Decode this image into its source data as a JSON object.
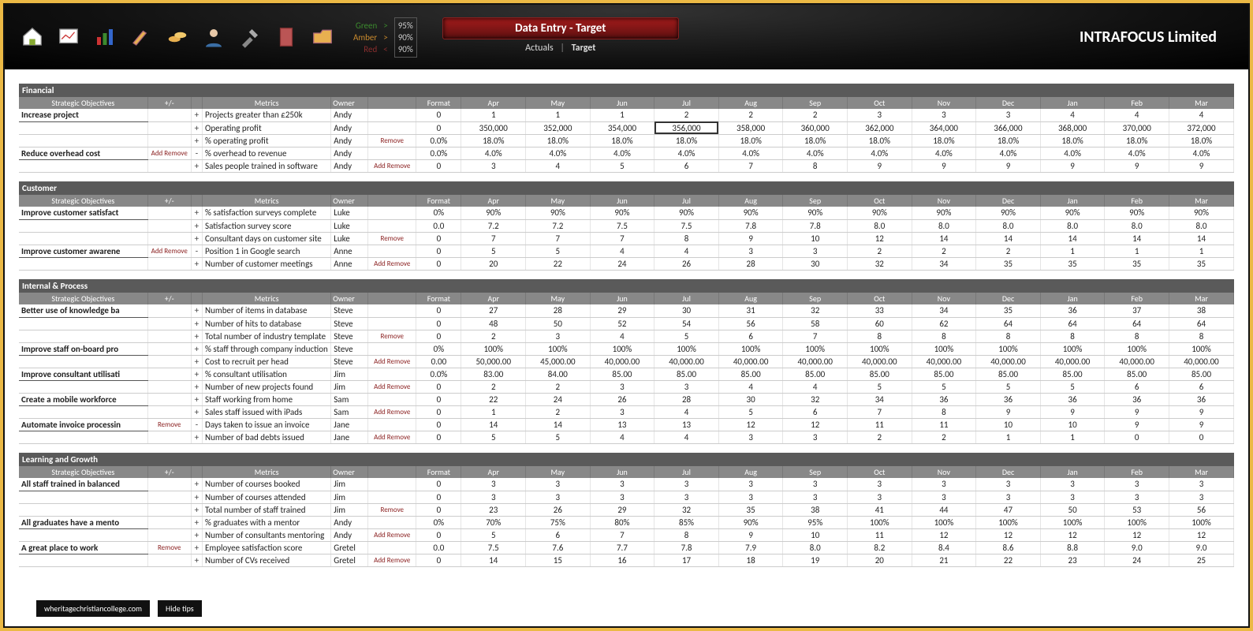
{
  "brand": "INTRAFOCUS Limited",
  "toolbar": {
    "title": "Data Entry - Target",
    "sub_actuals": "Actuals",
    "sub_sep": "|",
    "sub_target": "Target",
    "rag": {
      "green_label": "Green",
      "amber_label": "Amber",
      "red_label": "Red",
      "gt": ">",
      "lt": "<",
      "green_val": "95%",
      "amber_val": "90%",
      "red_val": "90%"
    }
  },
  "footer": {
    "domain": "wheritagechristiancollege.com",
    "hidetips": "Hide tips"
  },
  "col_headers": {
    "obj": "Strategic Objectives",
    "pm": "+/-",
    "metrics": "Metrics",
    "owner": "Owner",
    "format": "Format",
    "months": [
      "Apr",
      "May",
      "Jun",
      "Jul",
      "Aug",
      "Sep",
      "Oct",
      "Nov",
      "Dec",
      "Jan",
      "Feb",
      "Mar"
    ]
  },
  "sections": [
    {
      "title": "Financial",
      "rows": [
        {
          "obj": "Increase project",
          "objAR": "",
          "plus": "+",
          "metric": "Projects greater than £250k",
          "owner": "Andy",
          "ar": "",
          "fmt": "0",
          "v": [
            "1",
            "1",
            "1",
            "2",
            "2",
            "2",
            "3",
            "3",
            "3",
            "4",
            "4",
            "4"
          ]
        },
        {
          "obj": "",
          "objAR": "",
          "plus": "+",
          "metric": "Operating profit",
          "owner": "Andy",
          "ar": "",
          "fmt": "0",
          "v": [
            "350,000",
            "352,000",
            "354,000",
            "356,000",
            "358,000",
            "360,000",
            "362,000",
            "364,000",
            "366,000",
            "368,000",
            "370,000",
            "372,000"
          ],
          "selected": 3
        },
        {
          "obj": "",
          "objAR": "",
          "plus": "+",
          "metric": "% operating profit",
          "owner": "Andy",
          "ar": "Remove",
          "fmt": "0.0%",
          "v": [
            "18.0%",
            "18.0%",
            "18.0%",
            "18.0%",
            "18.0%",
            "18.0%",
            "18.0%",
            "18.0%",
            "18.0%",
            "18.0%",
            "18.0%",
            "18.0%"
          ]
        },
        {
          "obj": "Reduce overhead cost",
          "objAR": "Add  Remove",
          "plus": "-",
          "metric": "% overhead to revenue",
          "owner": "Andy",
          "ar": "",
          "fmt": "0.0%",
          "v": [
            "4.0%",
            "4.0%",
            "4.0%",
            "4.0%",
            "4.0%",
            "4.0%",
            "4.0%",
            "4.0%",
            "4.0%",
            "4.0%",
            "4.0%",
            "4.0%"
          ]
        },
        {
          "obj": "",
          "objAR": "",
          "plus": "+",
          "metric": "Sales people trained in software",
          "owner": "Andy",
          "ar": "Add  Remove",
          "fmt": "0",
          "v": [
            "3",
            "4",
            "5",
            "6",
            "7",
            "8",
            "9",
            "9",
            "9",
            "9",
            "9",
            "9"
          ]
        }
      ]
    },
    {
      "title": "Customer",
      "rows": [
        {
          "obj": "Improve customer satisfact",
          "objAR": "",
          "plus": "+",
          "metric": "% satisfaction surveys complete",
          "owner": "Luke",
          "ar": "",
          "fmt": "0%",
          "v": [
            "90%",
            "90%",
            "90%",
            "90%",
            "90%",
            "90%",
            "90%",
            "90%",
            "90%",
            "90%",
            "90%",
            "90%"
          ]
        },
        {
          "obj": "",
          "objAR": "",
          "plus": "+",
          "metric": "Satisfaction survey score",
          "owner": "Luke",
          "ar": "",
          "fmt": "0.0",
          "v": [
            "7.2",
            "7.2",
            "7.5",
            "7.5",
            "7.8",
            "7.8",
            "8.0",
            "8.0",
            "8.0",
            "8.0",
            "8.0",
            "8.0"
          ]
        },
        {
          "obj": "",
          "objAR": "",
          "plus": "+",
          "metric": "Consultant days on customer site",
          "owner": "Luke",
          "ar": "Remove",
          "fmt": "0",
          "v": [
            "7",
            "7",
            "7",
            "8",
            "9",
            "10",
            "12",
            "14",
            "14",
            "14",
            "14",
            "14"
          ]
        },
        {
          "obj": "Improve customer awarene",
          "objAR": "Add  Remove",
          "plus": "-",
          "metric": "Position 1 in Google search",
          "owner": "Anne",
          "ar": "",
          "fmt": "0",
          "v": [
            "5",
            "5",
            "4",
            "4",
            "3",
            "3",
            "2",
            "2",
            "2",
            "1",
            "1",
            "1"
          ]
        },
        {
          "obj": "",
          "objAR": "",
          "plus": "+",
          "metric": "Number of customer meetings",
          "owner": "Anne",
          "ar": "Add  Remove",
          "fmt": "0",
          "v": [
            "20",
            "22",
            "24",
            "26",
            "28",
            "30",
            "32",
            "34",
            "35",
            "35",
            "35",
            "35"
          ]
        }
      ]
    },
    {
      "title": "Internal & Process",
      "rows": [
        {
          "obj": "Better use of knowledge ba",
          "objAR": "",
          "plus": "+",
          "metric": "Number of items in database",
          "owner": "Steve",
          "ar": "",
          "fmt": "0",
          "v": [
            "27",
            "28",
            "29",
            "30",
            "31",
            "32",
            "33",
            "34",
            "35",
            "36",
            "37",
            "38"
          ]
        },
        {
          "obj": "",
          "objAR": "",
          "plus": "+",
          "metric": "Number of hits to database",
          "owner": "Steve",
          "ar": "",
          "fmt": "0",
          "v": [
            "48",
            "50",
            "52",
            "54",
            "56",
            "58",
            "60",
            "62",
            "64",
            "64",
            "64",
            "64"
          ]
        },
        {
          "obj": "",
          "objAR": "",
          "plus": "+",
          "metric": "Total number of industry template",
          "owner": "Steve",
          "ar": "Remove",
          "fmt": "0",
          "v": [
            "2",
            "3",
            "4",
            "5",
            "6",
            "7",
            "8",
            "8",
            "8",
            "8",
            "8",
            "8"
          ]
        },
        {
          "obj": "Improve staff on-board pro",
          "objAR": "",
          "plus": "+",
          "metric": "% staff through company induction",
          "owner": "Steve",
          "ar": "",
          "fmt": "0%",
          "v": [
            "100%",
            "100%",
            "100%",
            "100%",
            "100%",
            "100%",
            "100%",
            "100%",
            "100%",
            "100%",
            "100%",
            "100%"
          ]
        },
        {
          "obj": "",
          "objAR": "",
          "plus": "+",
          "metric": "Cost to recruit per head",
          "owner": "Steve",
          "ar": "Add  Remove",
          "fmt": "0.00",
          "v": [
            "50,000.00",
            "45,000.00",
            "40,000.00",
            "40,000.00",
            "40,000.00",
            "40,000.00",
            "40,000.00",
            "40,000.00",
            "40,000.00",
            "40,000.00",
            "40,000.00",
            "40,000.00"
          ]
        },
        {
          "obj": "Improve consultant utilisati",
          "objAR": "",
          "plus": "+",
          "metric": "% consultant utilisation",
          "owner": "Jim",
          "ar": "",
          "fmt": "0.0%",
          "v": [
            "83.00",
            "84.00",
            "85.00",
            "85.00",
            "85.00",
            "85.00",
            "85.00",
            "85.00",
            "85.00",
            "85.00",
            "85.00",
            "85.00"
          ]
        },
        {
          "obj": "",
          "objAR": "",
          "plus": "+",
          "metric": "Number of new projects found",
          "owner": "Jim",
          "ar": "Add  Remove",
          "fmt": "0",
          "v": [
            "2",
            "2",
            "3",
            "3",
            "4",
            "4",
            "5",
            "5",
            "5",
            "5",
            "6",
            "6"
          ]
        },
        {
          "obj": "Create a mobile workforce",
          "objAR": "",
          "plus": "+",
          "metric": "Staff working from home",
          "owner": "Sam",
          "ar": "",
          "fmt": "0",
          "v": [
            "22",
            "24",
            "26",
            "28",
            "30",
            "32",
            "34",
            "36",
            "36",
            "36",
            "36",
            "36"
          ]
        },
        {
          "obj": "",
          "objAR": "",
          "plus": "+",
          "metric": "Sales staff issued with iPads",
          "owner": "Sam",
          "ar": "Add  Remove",
          "fmt": "0",
          "v": [
            "1",
            "2",
            "3",
            "4",
            "5",
            "6",
            "7",
            "8",
            "9",
            "9",
            "9",
            "9"
          ]
        },
        {
          "obj": "Automate invoice processin",
          "objAR": "Remove",
          "plus": "-",
          "metric": "Days taken to issue an invoice",
          "owner": "Jane",
          "ar": "",
          "fmt": "0",
          "v": [
            "14",
            "14",
            "13",
            "13",
            "12",
            "12",
            "11",
            "11",
            "10",
            "10",
            "9",
            "9"
          ]
        },
        {
          "obj": "",
          "objAR": "",
          "plus": "+",
          "metric": "Number of bad debts issued",
          "owner": "Jane",
          "ar": "Add  Remove",
          "fmt": "0",
          "v": [
            "5",
            "5",
            "4",
            "4",
            "3",
            "3",
            "2",
            "2",
            "1",
            "1",
            "0",
            "0"
          ]
        }
      ]
    },
    {
      "title": "Learning and Growth",
      "rows": [
        {
          "obj": "All staff trained in balanced",
          "objAR": "",
          "plus": "+",
          "metric": "Number of courses booked",
          "owner": "Jim",
          "ar": "",
          "fmt": "0",
          "v": [
            "3",
            "3",
            "3",
            "3",
            "3",
            "3",
            "3",
            "3",
            "3",
            "3",
            "3",
            "3"
          ]
        },
        {
          "obj": "",
          "objAR": "",
          "plus": "+",
          "metric": "Number of courses attended",
          "owner": "Jim",
          "ar": "",
          "fmt": "0",
          "v": [
            "3",
            "3",
            "3",
            "3",
            "3",
            "3",
            "3",
            "3",
            "3",
            "3",
            "3",
            "3"
          ]
        },
        {
          "obj": "",
          "objAR": "",
          "plus": "+",
          "metric": "Total number of staff trained",
          "owner": "Jim",
          "ar": "Remove",
          "fmt": "0",
          "v": [
            "23",
            "26",
            "29",
            "32",
            "35",
            "38",
            "41",
            "44",
            "47",
            "50",
            "53",
            "56"
          ]
        },
        {
          "obj": "All graduates have a mento",
          "objAR": "",
          "plus": "+",
          "metric": "% graduates with a mentor",
          "owner": "Andy",
          "ar": "",
          "fmt": "0%",
          "v": [
            "70%",
            "75%",
            "80%",
            "85%",
            "90%",
            "95%",
            "100%",
            "100%",
            "100%",
            "100%",
            "100%",
            "100%"
          ]
        },
        {
          "obj": "",
          "objAR": "",
          "plus": "+",
          "metric": "Number of consultants mentoring",
          "owner": "Andy",
          "ar": "Add  Remove",
          "fmt": "0",
          "v": [
            "5",
            "6",
            "7",
            "8",
            "9",
            "10",
            "11",
            "12",
            "12",
            "12",
            "12",
            "12"
          ]
        },
        {
          "obj": "A great place to work",
          "objAR": "Remove",
          "plus": "+",
          "metric": "Employee satisfaction score",
          "owner": "Gretel",
          "ar": "",
          "fmt": "0.0",
          "v": [
            "7.5",
            "7.6",
            "7.7",
            "7.8",
            "7.9",
            "8.0",
            "8.2",
            "8.4",
            "8.6",
            "8.8",
            "9.0",
            "9.0"
          ]
        },
        {
          "obj": "",
          "objAR": "",
          "plus": "+",
          "metric": "Number of CVs received",
          "owner": "Gretel",
          "ar": "Add  Remove",
          "fmt": "0",
          "v": [
            "14",
            "15",
            "16",
            "17",
            "18",
            "19",
            "20",
            "21",
            "22",
            "23",
            "24",
            "25"
          ]
        }
      ]
    }
  ]
}
